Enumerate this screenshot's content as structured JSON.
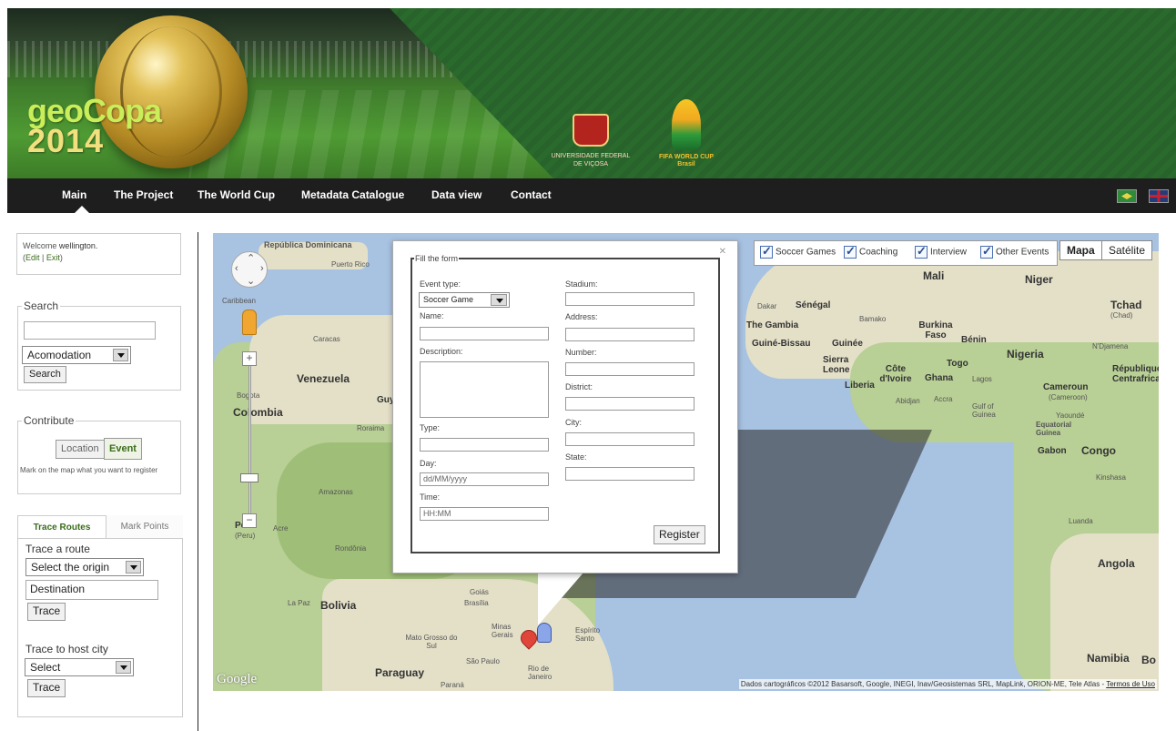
{
  "banner": {
    "logo_top": "geoCopa",
    "logo_bottom": "2014",
    "ufv_line1": "Universidade Federal",
    "ufv_line2": "de Viçosa",
    "fifa_line1": "FIFA WORLD CUP",
    "fifa_line2": "Brasil"
  },
  "nav": {
    "items": [
      "Main",
      "The Project",
      "The World Cup",
      "Metadata Catalogue",
      "Data view",
      "Contact"
    ]
  },
  "sidebar": {
    "welcome_prefix": "Welcome ",
    "username": "wellington.",
    "edit": "Edit",
    "sep": " | ",
    "exit": "Exit",
    "paren_open": "(",
    "paren_close": ")",
    "search": {
      "legend": "Search",
      "input_value": "",
      "select_value": "Acomodation",
      "button": "Search"
    },
    "contribute": {
      "legend": "Contribute",
      "location_button": "Location",
      "event_button": "Event",
      "note": "Mark on the map what you want to register"
    },
    "tabs": {
      "trace_routes": "Trace Routes",
      "mark_points": "Mark Points",
      "trace_a_route": "Trace a route",
      "origin_select": "Select the origin",
      "destination_value": "Destination",
      "trace_button": "Trace",
      "trace_to_host": "Trace to host city",
      "host_select": "Select",
      "trace_button2": "Trace"
    }
  },
  "map": {
    "layers": [
      {
        "label": "Soccer Games",
        "checked": true
      },
      {
        "label": "Coaching",
        "checked": true
      },
      {
        "label": "Interview",
        "checked": true
      },
      {
        "label": "Other Events",
        "checked": true
      }
    ],
    "map_type_map": "Mapa",
    "map_type_satellite": "Satélite",
    "attribution": "Dados cartográficos ©2012 Basarsoft, Google, INEGI, Inav/Geosistemas SRL, MapLink, ORION-ME, Tele Atlas - ",
    "terms": "Termos de Uso",
    "google": "Google",
    "labels": {
      "rep_dom": "República Dominicana",
      "puerto_rico": "Puerto Rico",
      "caribbean": "Caribbean",
      "caracas": "Caracas",
      "venezuela": "Venezuela",
      "bogota": "Bogota",
      "colombia": "Colombia",
      "roraima": "Roraima",
      "guy": "Guy",
      "amazonas": "Amazonas",
      "peru": "Peru",
      "peru2": "(Peru)",
      "acre": "Acre",
      "rondonia": "Rondônia",
      "lapaz": "La Paz",
      "bolivia": "Bolivia",
      "paraguay": "Paraguay",
      "matogrosso": "Mato Grosso do Sul",
      "goias": "Goiás",
      "brasilia": "Brasília",
      "minas": "Minas Gerais",
      "saopaulo": "São Paulo",
      "rio": "Rio de Janeiro",
      "espirito": "Espírito Santo",
      "parana": "Paraná",
      "mali": "Mali",
      "niger": "Niger",
      "tchad": "Tchad",
      "tchad2": "(Chad)",
      "senegal": "Sénégal",
      "dakar": "Dakar",
      "gambia": "The Gambia",
      "bamako": "Bamako",
      "burkina": "Burkina Faso",
      "guinea_bissau": "Guiné-Bissau",
      "guinee": "Guinée",
      "benin": "Bénin",
      "ndjamena": "N'Djamena",
      "nigeria": "Nigeria",
      "sierra": "Sierra Leone",
      "cote": "Côte d'Ivoire",
      "togo": "Togo",
      "ghana": "Ghana",
      "lagos": "Lagos",
      "liberia": "Liberia",
      "abidjan": "Abidjan",
      "accra": "Accra",
      "gulf": "Gulf of Guinea",
      "cameroun": "Cameroun",
      "cameroun2": "(Cameroon)",
      "yaounde": "Yaoundé",
      "republic": "République Centrafricaine",
      "eqguinea": "Equatorial Guinea",
      "gabon": "Gabon",
      "congo": "Congo",
      "kinshasa": "Kinshasa",
      "luanda": "Luanda",
      "angola": "Angola",
      "namibia": "Namibia",
      "bo": "Bo"
    }
  },
  "form": {
    "legend": "Fill the form",
    "event_type_label": "Event type:",
    "event_type_value": "Soccer Game",
    "name_label": "Name:",
    "description_label": "Description:",
    "type_label": "Type:",
    "day_label": "Day:",
    "day_placeholder": "dd/MM/yyyy",
    "time_label": "Time:",
    "time_placeholder": "HH:MM",
    "stadium_label": "Stadium:",
    "address_label": "Address:",
    "number_label": "Number:",
    "district_label": "District:",
    "city_label": "City:",
    "state_label": "State:",
    "register_button": "Register"
  }
}
